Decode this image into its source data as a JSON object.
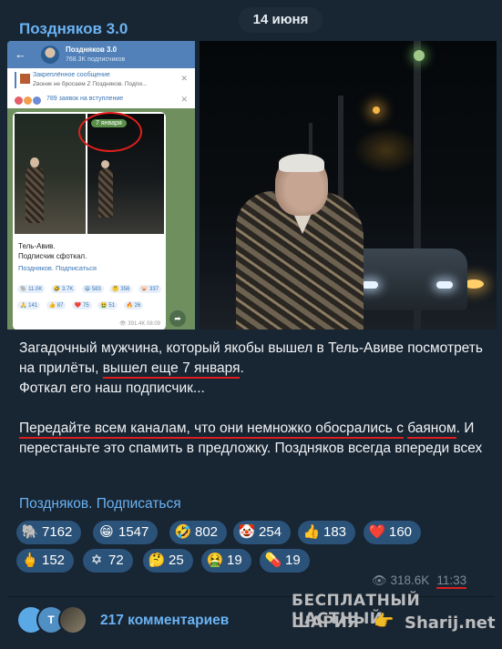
{
  "header": {
    "channel_name": "Поздняков 3.0",
    "date": "14 июня"
  },
  "screenshot_inset": {
    "back_icon": "←",
    "title": "Поздняков 3.0",
    "subscribers": "768.3K подписчиков",
    "pinned_title": "Закреплённое сообщение",
    "pinned_text": "Zвоник не бросаем Z Поздняков. Подпи...",
    "close_icon": "✕",
    "requests_text": "789 заявок на вступление",
    "date_tag": "7 января",
    "caption_line1": "Тель-Авив.",
    "caption_line2": "Подписчик сфоткал.",
    "subscribe": "Поздняков. Подписаться",
    "reactions": [
      {
        "emoji": "🐘",
        "count": "11.0K"
      },
      {
        "emoji": "🤣",
        "count": "3.7K"
      },
      {
        "emoji": "😆",
        "count": "583"
      },
      {
        "emoji": "🤔",
        "count": "356"
      },
      {
        "emoji": "🐷",
        "count": "337"
      },
      {
        "emoji": "🙏",
        "count": "141"
      },
      {
        "emoji": "👍",
        "count": "87"
      },
      {
        "emoji": "❤️",
        "count": "75"
      },
      {
        "emoji": "🤮",
        "count": "51"
      },
      {
        "emoji": "🔥",
        "count": "26"
      }
    ],
    "views": "👁 391.4K 08:09",
    "share_icon": "➦"
  },
  "body": {
    "p1_part1": "Загадочный мужчина, который якобы вышел в Тель-Авиве посмотреть на прилёты, ",
    "p1_underlined": "вышел еще 7 января",
    "p1_part2": ".",
    "p2": "Фоткал его наш подписчик...",
    "p3_underlined1": "Передайте всем каналам, что они немножко обосрались с",
    "p3_underlined2": "баяном",
    "p3_rest": ". И перестаньте это спамить в предложку. Поздняков всегда впереди всех"
  },
  "subscribe_link": "Поздняков. Подписаться",
  "reactions": [
    {
      "emoji": "🐘",
      "count": "7162"
    },
    {
      "emoji": "😁",
      "count": "1547"
    },
    {
      "emoji": "🤣",
      "count": "802"
    },
    {
      "emoji": "🤡",
      "count": "254"
    },
    {
      "emoji": "👍",
      "count": "183"
    },
    {
      "emoji": "❤️",
      "count": "160"
    },
    {
      "emoji": "🖕",
      "count": "152"
    },
    {
      "emoji": "✡",
      "count": "72"
    },
    {
      "emoji": "🤔",
      "count": "25"
    },
    {
      "emoji": "🤮",
      "count": "19"
    },
    {
      "emoji": "💊",
      "count": "19"
    }
  ],
  "meta": {
    "eye_icon": "👁",
    "views": "318.6K",
    "time": "11:33"
  },
  "comments": {
    "avatar_letter": "T",
    "label": "217 комментариев"
  },
  "watermark": {
    "line1": "БЕСПЛАТНЫЙ ЧАСТНЫЙ",
    "line2": "ШАРИЯ",
    "hand_icon": "👉",
    "site": "Sharij.net"
  }
}
